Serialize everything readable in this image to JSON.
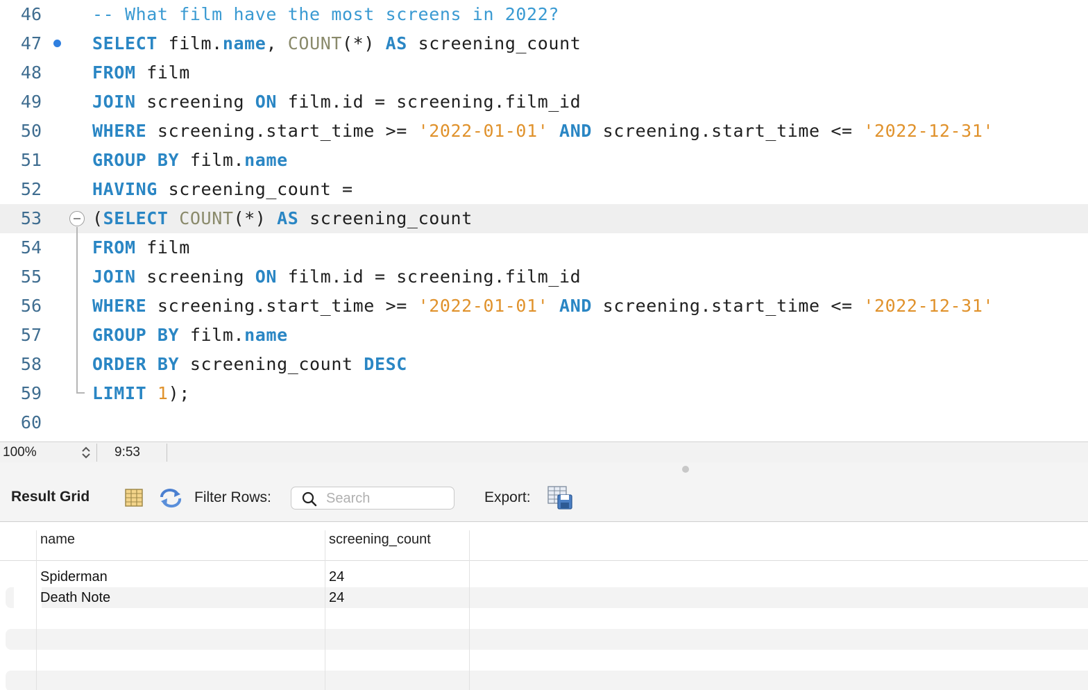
{
  "editor": {
    "lines": [
      {
        "num": "46",
        "tokens": [
          {
            "t": "-- What film have the most screens in 2022?",
            "c": "cm"
          }
        ]
      },
      {
        "num": "47",
        "tokens": [
          {
            "t": "SELECT",
            "c": "kw"
          },
          {
            "t": " film.",
            "c": ""
          },
          {
            "t": "name",
            "c": "kw"
          },
          {
            "t": ", ",
            "c": ""
          },
          {
            "t": "COUNT",
            "c": "fn"
          },
          {
            "t": "(*) ",
            "c": ""
          },
          {
            "t": "AS",
            "c": "kw"
          },
          {
            "t": " screening_count",
            "c": ""
          }
        ]
      },
      {
        "num": "48",
        "tokens": [
          {
            "t": "FROM",
            "c": "kw"
          },
          {
            "t": " film",
            "c": ""
          }
        ]
      },
      {
        "num": "49",
        "tokens": [
          {
            "t": "JOIN",
            "c": "kw"
          },
          {
            "t": " screening ",
            "c": ""
          },
          {
            "t": "ON",
            "c": "kw"
          },
          {
            "t": " film.id = screening.film_id",
            "c": ""
          }
        ]
      },
      {
        "num": "50",
        "tokens": [
          {
            "t": "WHERE",
            "c": "kw"
          },
          {
            "t": " screening.start_time >= ",
            "c": ""
          },
          {
            "t": "'2022-01-01'",
            "c": "str"
          },
          {
            "t": " ",
            "c": ""
          },
          {
            "t": "AND",
            "c": "kw"
          },
          {
            "t": " screening.start_time <= ",
            "c": ""
          },
          {
            "t": "'2022-12-31'",
            "c": "str"
          }
        ]
      },
      {
        "num": "51",
        "tokens": [
          {
            "t": "GROUP BY",
            "c": "kw"
          },
          {
            "t": " film.",
            "c": ""
          },
          {
            "t": "name",
            "c": "kw"
          }
        ]
      },
      {
        "num": "52",
        "tokens": [
          {
            "t": "HAVING",
            "c": "kw"
          },
          {
            "t": " screening_count =",
            "c": ""
          }
        ]
      },
      {
        "num": "53",
        "current": true,
        "tokens": [
          {
            "t": "(",
            "c": ""
          },
          {
            "t": "SELECT",
            "c": "kw"
          },
          {
            "t": " ",
            "c": ""
          },
          {
            "t": "COUNT",
            "c": "fn"
          },
          {
            "t": "(*) ",
            "c": ""
          },
          {
            "t": "AS",
            "c": "kw"
          },
          {
            "t": " screening_count",
            "c": ""
          }
        ]
      },
      {
        "num": "54",
        "tokens": [
          {
            "t": "FROM",
            "c": "kw"
          },
          {
            "t": " film",
            "c": ""
          }
        ]
      },
      {
        "num": "55",
        "tokens": [
          {
            "t": "JOIN",
            "c": "kw"
          },
          {
            "t": " screening ",
            "c": ""
          },
          {
            "t": "ON",
            "c": "kw"
          },
          {
            "t": " film.id = screening.film_id",
            "c": ""
          }
        ]
      },
      {
        "num": "56",
        "tokens": [
          {
            "t": "WHERE",
            "c": "kw"
          },
          {
            "t": " screening.start_time >= ",
            "c": ""
          },
          {
            "t": "'2022-01-01'",
            "c": "str"
          },
          {
            "t": " ",
            "c": ""
          },
          {
            "t": "AND",
            "c": "kw"
          },
          {
            "t": " screening.start_time <= ",
            "c": ""
          },
          {
            "t": "'2022-12-31'",
            "c": "str"
          }
        ]
      },
      {
        "num": "57",
        "tokens": [
          {
            "t": "GROUP BY",
            "c": "kw"
          },
          {
            "t": " film.",
            "c": ""
          },
          {
            "t": "name",
            "c": "kw"
          }
        ]
      },
      {
        "num": "58",
        "tokens": [
          {
            "t": "ORDER BY",
            "c": "kw"
          },
          {
            "t": " screening_count ",
            "c": ""
          },
          {
            "t": "DESC",
            "c": "kw"
          }
        ]
      },
      {
        "num": "59",
        "tokens": [
          {
            "t": "LIMIT",
            "c": "kw"
          },
          {
            "t": " ",
            "c": ""
          },
          {
            "t": "1",
            "c": "num"
          },
          {
            "t": ");",
            "c": ""
          }
        ]
      },
      {
        "num": "60",
        "tokens": []
      }
    ]
  },
  "statusbar": {
    "zoom": "100%",
    "cursor_position": "9:53"
  },
  "result_toolbar": {
    "title": "Result Grid",
    "filter_label": "Filter Rows:",
    "search_placeholder": "Search",
    "export_label": "Export:"
  },
  "grid": {
    "columns": [
      "name",
      "screening_count"
    ],
    "rows": [
      [
        "Spiderman",
        "24"
      ],
      [
        "Death Note",
        "24"
      ]
    ]
  },
  "icons": {
    "breakpoint": "breakpoint-dot-icon",
    "fold": "fold-collapse-icon",
    "zoom_stepper": "up-down-stepper-icon",
    "grid_layout": "grid-layout-icon",
    "refresh": "refresh-icon",
    "search": "search-icon",
    "export": "export-table-icon"
  },
  "colors": {
    "keyword": "#2a86c4",
    "function": "#8a8a6b",
    "string": "#e0922c",
    "comment": "#3a9ad2",
    "line_number": "#3f6d90",
    "breakpoint": "#2f7fe0"
  }
}
